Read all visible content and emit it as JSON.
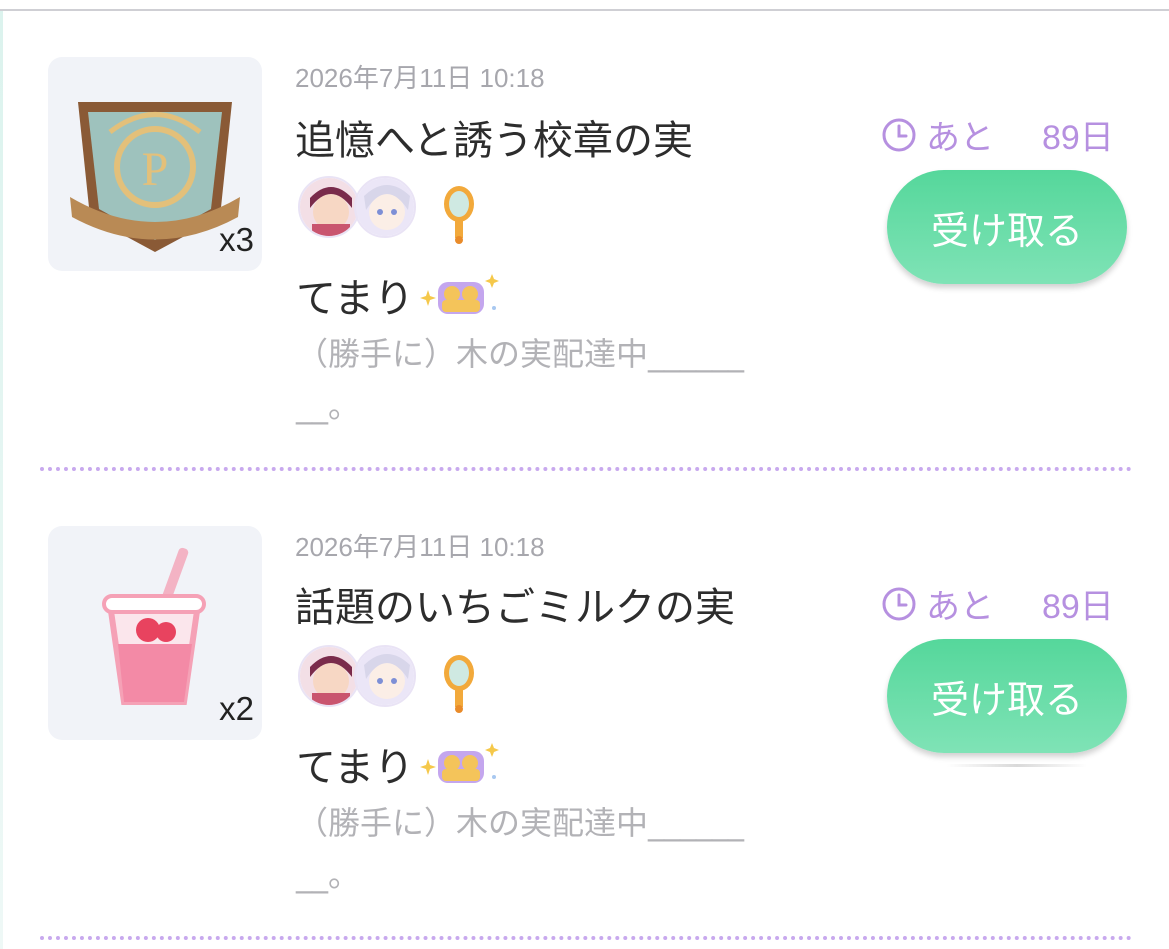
{
  "colors": {
    "accent_purple": "#b690e0",
    "button_green": "#55d79b",
    "divider_dots": "#c8a9ee",
    "title_text": "#2d2d2d",
    "muted_text": "#a7a7ad"
  },
  "items": [
    {
      "item_icon": "school-crest-icon",
      "quantity": "x3",
      "date": "2026年7月11日 10:18",
      "title": "追憶へと誘う校章の実",
      "sender_name": "てまり",
      "sender_badge_icon": "sparkle-couple-icon",
      "message_line1": "（勝手に）木の実配達中______",
      "message_line2": "__。",
      "expiry_prefix": "あと",
      "expiry_days": "89日",
      "receive_label": "受け取る"
    },
    {
      "item_icon": "strawberry-milk-icon",
      "quantity": "x2",
      "date": "2026年7月11日 10:18",
      "title": "話題のいちごミルクの実",
      "sender_name": "てまり",
      "sender_badge_icon": "sparkle-couple-icon",
      "message_line1": "（勝手に）木の実配達中______",
      "message_line2": "__。",
      "expiry_prefix": "あと",
      "expiry_days": "89日",
      "receive_label": "受け取る"
    }
  ]
}
